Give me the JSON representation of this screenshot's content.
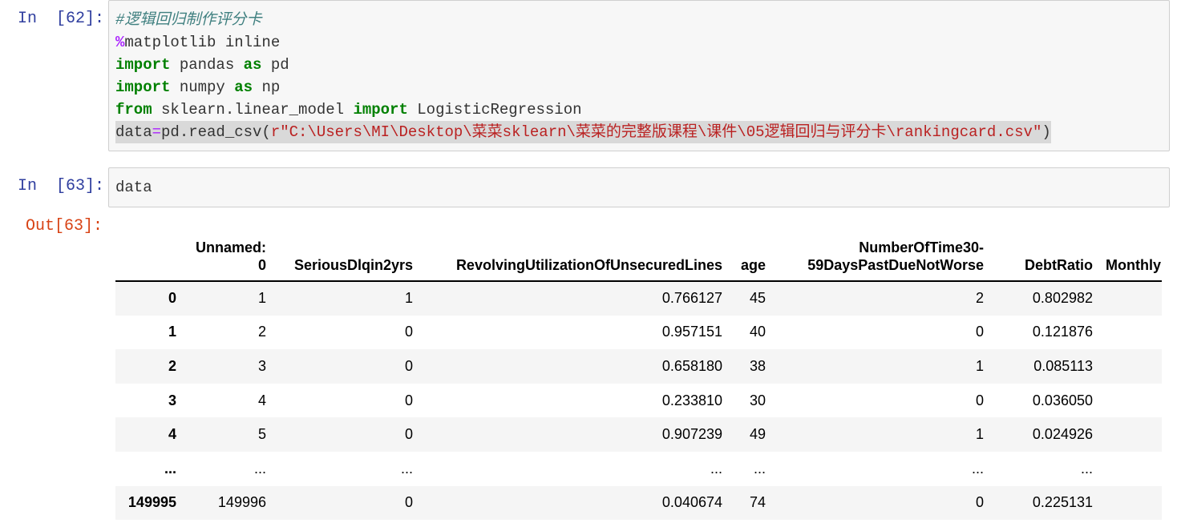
{
  "cells": [
    {
      "prompt": "In  [62]:",
      "lines": {
        "comment": "#逻辑回归制作评分卡",
        "magic_sym": "%",
        "magic_rest": "matplotlib inline",
        "l3_kw1": "import",
        "l3_mod": " pandas ",
        "l3_kw2": "as",
        "l3_alias": " pd",
        "l4_kw1": "import",
        "l4_mod": " numpy ",
        "l4_kw2": "as",
        "l4_alias": " np",
        "l5_kw1": "from",
        "l5_mod": " sklearn.linear_model ",
        "l5_kw2": "import",
        "l5_name": " LogisticRegression",
        "l6_pre": "data",
        "l6_eq": "=",
        "l6_call": "pd.read_csv(",
        "l6_str": "r\"C:\\Users\\MI\\Desktop\\菜菜sklearn\\菜菜的完整版课程\\课件\\05逻辑回归与评分卡\\rankingcard.csv\"",
        "l6_close": ")"
      }
    },
    {
      "prompt": "In  [63]:",
      "code": "data"
    }
  ],
  "output": {
    "prompt": "Out[63]:",
    "columns": [
      "",
      "Unnamed: 0",
      "SeriousDlqin2yrs",
      "RevolvingUtilizationOfUnsecuredLines",
      "age",
      "NumberOfTime30-59DaysPastDueNotWorse",
      "DebtRatio",
      "Monthly"
    ],
    "rows": [
      [
        "0",
        "1",
        "1",
        "0.766127",
        "45",
        "2",
        "0.802982",
        ""
      ],
      [
        "1",
        "2",
        "0",
        "0.957151",
        "40",
        "0",
        "0.121876",
        ""
      ],
      [
        "2",
        "3",
        "0",
        "0.658180",
        "38",
        "1",
        "0.085113",
        ""
      ],
      [
        "3",
        "4",
        "0",
        "0.233810",
        "30",
        "0",
        "0.036050",
        ""
      ],
      [
        "4",
        "5",
        "0",
        "0.907239",
        "49",
        "1",
        "0.024926",
        ""
      ],
      [
        "...",
        "...",
        "...",
        "...",
        "...",
        "...",
        "...",
        ""
      ],
      [
        "149995",
        "149996",
        "0",
        "0.040674",
        "74",
        "0",
        "0.225131",
        ""
      ]
    ]
  }
}
